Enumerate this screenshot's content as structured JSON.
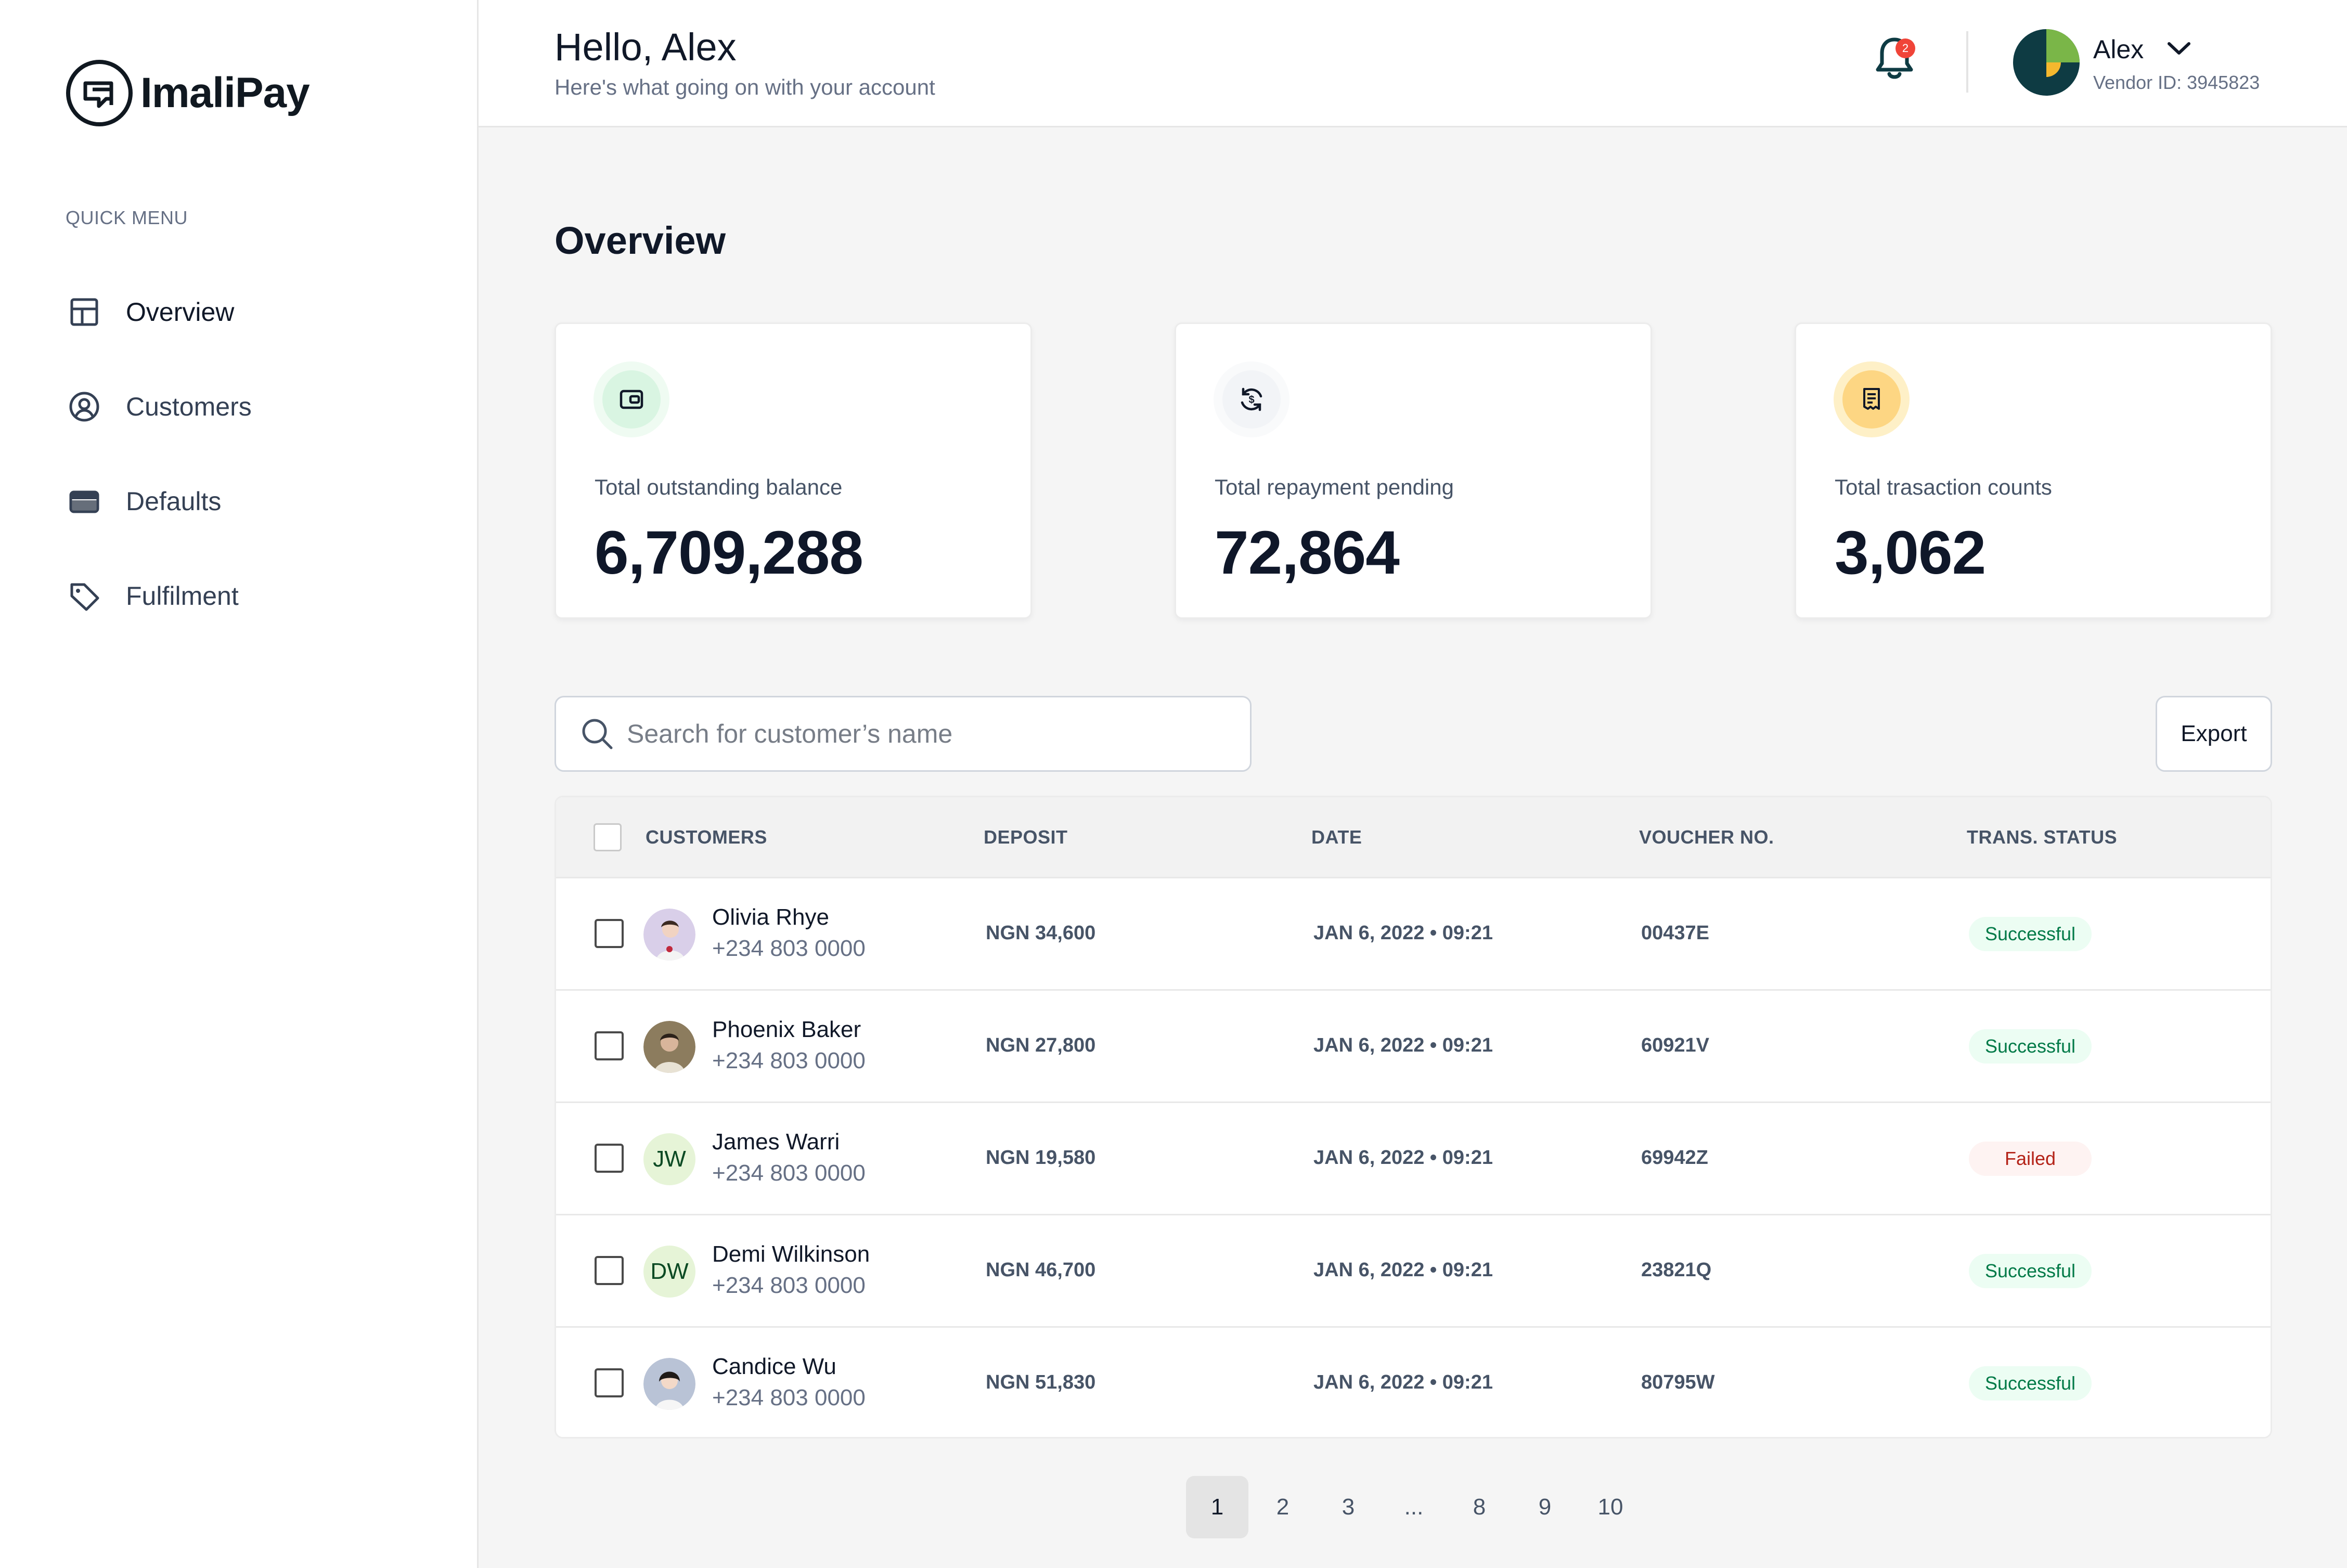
{
  "brand": {
    "name": "ImaliPay"
  },
  "sidebar": {
    "section_label": "QUICK MENU",
    "items": [
      {
        "label": "Overview",
        "icon": "layout-icon",
        "active": true
      },
      {
        "label": "Customers",
        "icon": "user-circle-icon",
        "active": false
      },
      {
        "label": "Defaults",
        "icon": "wallet-card-icon",
        "active": false
      },
      {
        "label": "Fulfilment",
        "icon": "tag-icon",
        "active": false
      }
    ]
  },
  "header": {
    "greeting": "Hello, Alex",
    "subtitle": "Here's what going on with your account",
    "notifications": {
      "count": "2"
    },
    "user": {
      "name": "Alex",
      "vendor": "Vendor ID: 3945823"
    }
  },
  "page": {
    "title": "Overview"
  },
  "stats": [
    {
      "label": "Total outstanding balance",
      "value": "6,709,288",
      "icon": "wallet-icon",
      "accent": "#dff7e6"
    },
    {
      "label": "Total repayment pending",
      "value": "72,864",
      "icon": "refresh-dollar-icon",
      "accent": "#f2f4f7"
    },
    {
      "label": "Total trasaction counts",
      "value": "3,062",
      "icon": "receipt-icon",
      "accent": "#fde3a7"
    }
  ],
  "search": {
    "placeholder": "Search for customer’s name",
    "value": ""
  },
  "export": {
    "label": "Export"
  },
  "table": {
    "columns": [
      "CUSTOMERS",
      "DEPOSIT",
      "DATE",
      "VOUCHER NO.",
      "TRANS. STATUS"
    ],
    "rows": [
      {
        "name": "Olivia Rhye",
        "phone": "+234 803 0000",
        "deposit": "NGN 34,600",
        "date": "JAN 6, 2022 • 09:21",
        "voucher": "00437E",
        "status": "Successful",
        "avatar": "photo"
      },
      {
        "name": "Phoenix Baker",
        "phone": "+234 803 0000",
        "deposit": "NGN 27,800",
        "date": "JAN 6, 2022 • 09:21",
        "voucher": "60921V",
        "status": "Successful",
        "avatar": "photo"
      },
      {
        "name": "James Warri",
        "phone": "+234 803 0000",
        "deposit": "NGN 19,580",
        "date": "JAN 6, 2022 • 09:21",
        "voucher": "69942Z",
        "status": "Failed",
        "avatar": "initials",
        "initials": "JW"
      },
      {
        "name": "Demi Wilkinson",
        "phone": "+234 803 0000",
        "deposit": "NGN 46,700",
        "date": "JAN 6, 2022 • 09:21",
        "voucher": "23821Q",
        "status": "Successful",
        "avatar": "initials",
        "initials": "DW"
      },
      {
        "name": "Candice Wu",
        "phone": "+234 803 0000",
        "deposit": "NGN 51,830",
        "date": "JAN 6, 2022 • 09:21",
        "voucher": "80795W",
        "status": "Successful",
        "avatar": "photo"
      }
    ]
  },
  "pagination": {
    "pages": [
      "1",
      "2",
      "3",
      "...",
      "8",
      "9",
      "10"
    ],
    "current": "1"
  },
  "colors": {
    "success_bg": "#ecfdf3",
    "success_text": "#027a48",
    "failed_bg": "#fef3f2",
    "failed_text": "#b42318",
    "brand_dark": "#0e3b43"
  }
}
